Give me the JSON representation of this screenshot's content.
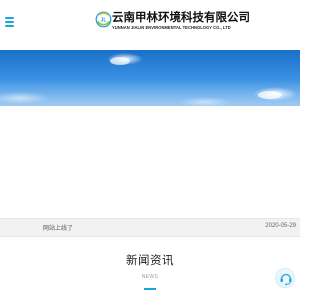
{
  "header": {
    "logo_mark_text": "JL",
    "company_name_cn": "云南甲林环境科技有限公司",
    "company_name_en": "YUNNAN JIALIN ENVIRONMENTAL TECHNOLOGY CO., LTD",
    "menu_icon": "hamburger-menu-icon"
  },
  "notice": {
    "title": "网站上线了",
    "date": "2020-05-29"
  },
  "news": {
    "title": "新闻资讯",
    "subtitle": "NEWS"
  },
  "service": {
    "icon": "customer-service-icon"
  },
  "colors": {
    "accent": "#19a6d8",
    "sky_top": "#1a70c9",
    "sky_bottom": "#6db0ee",
    "logo_green": "#8cc63f",
    "logo_yellow": "#f2c316"
  }
}
